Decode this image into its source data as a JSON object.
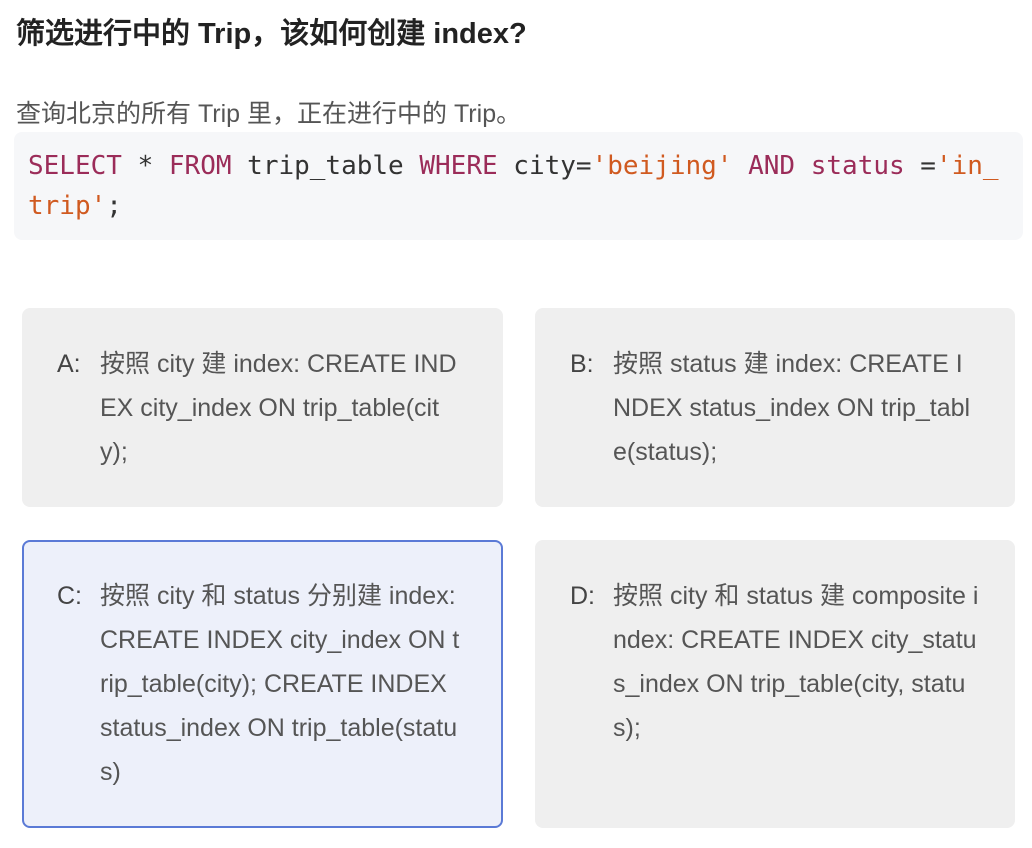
{
  "question": {
    "title": "筛选进行中的 Trip，该如何创建 index?",
    "description": "查询北京的所有 Trip 里，正在进行中的 Trip。"
  },
  "code": [
    {
      "t": "SELECT",
      "c": "kw"
    },
    {
      "t": " * ",
      "c": ""
    },
    {
      "t": "FROM",
      "c": "kw"
    },
    {
      "t": " trip_table ",
      "c": ""
    },
    {
      "t": "WHERE",
      "c": "kw"
    },
    {
      "t": " city=",
      "c": ""
    },
    {
      "t": "'beijing'",
      "c": "str"
    },
    {
      "t": " ",
      "c": ""
    },
    {
      "t": "AND",
      "c": "kw"
    },
    {
      "t": " ",
      "c": ""
    },
    {
      "t": "status",
      "c": "kw"
    },
    {
      "t": " =",
      "c": ""
    },
    {
      "t": "'in_trip'",
      "c": "str"
    },
    {
      "t": ";",
      "c": ""
    }
  ],
  "options": [
    {
      "label": "A:",
      "text": "按照 city 建 index: CREATE INDEX city_index ON trip_table(city);",
      "selected": false
    },
    {
      "label": "B:",
      "text": "按照 status 建 index: CREATE INDEX status_index ON trip_table(status);",
      "selected": false
    },
    {
      "label": "C:",
      "text": "按照 city 和 status 分别建 index: CREATE INDEX city_index ON trip_table(city); CREATE INDEX status_index ON trip_table(status)",
      "selected": true
    },
    {
      "label": "D:",
      "text": "按照 city 和 status 建 composite index: CREATE INDEX city_status_index ON trip_table(city, status);",
      "selected": false
    }
  ],
  "colors": {
    "keyword": "#9b2c59",
    "string": "#d05a20",
    "selected_border": "#5b7ad6",
    "selected_bg": "#edf0fa"
  }
}
